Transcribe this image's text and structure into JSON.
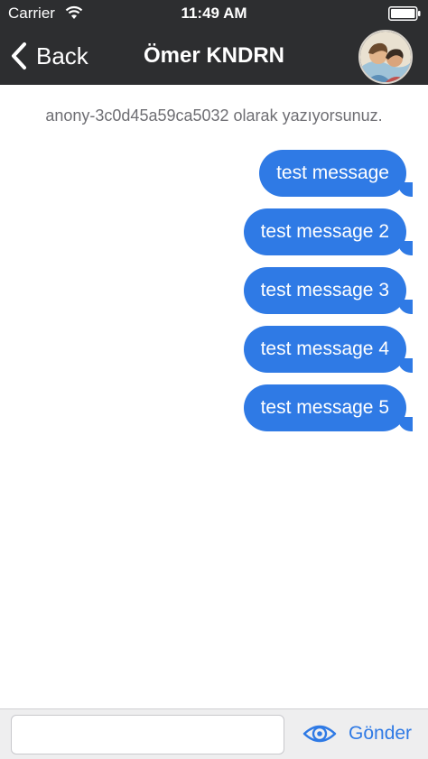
{
  "status_bar": {
    "carrier": "Carrier",
    "time": "11:49 AM"
  },
  "nav": {
    "back_label": "Back",
    "title": "Ömer KNDRN"
  },
  "info_text": "anony-3c0d45a59ca5032 olarak yazıyorsunuz.",
  "messages": [
    "test message",
    "test message 2",
    "test message 3",
    "test message 4",
    "test message 5"
  ],
  "composer": {
    "input_value": "",
    "send_label": "Gönder"
  },
  "colors": {
    "nav_background": "#2d2e30",
    "bubble": "#2f7ae5",
    "accent": "#2f7ae5"
  }
}
